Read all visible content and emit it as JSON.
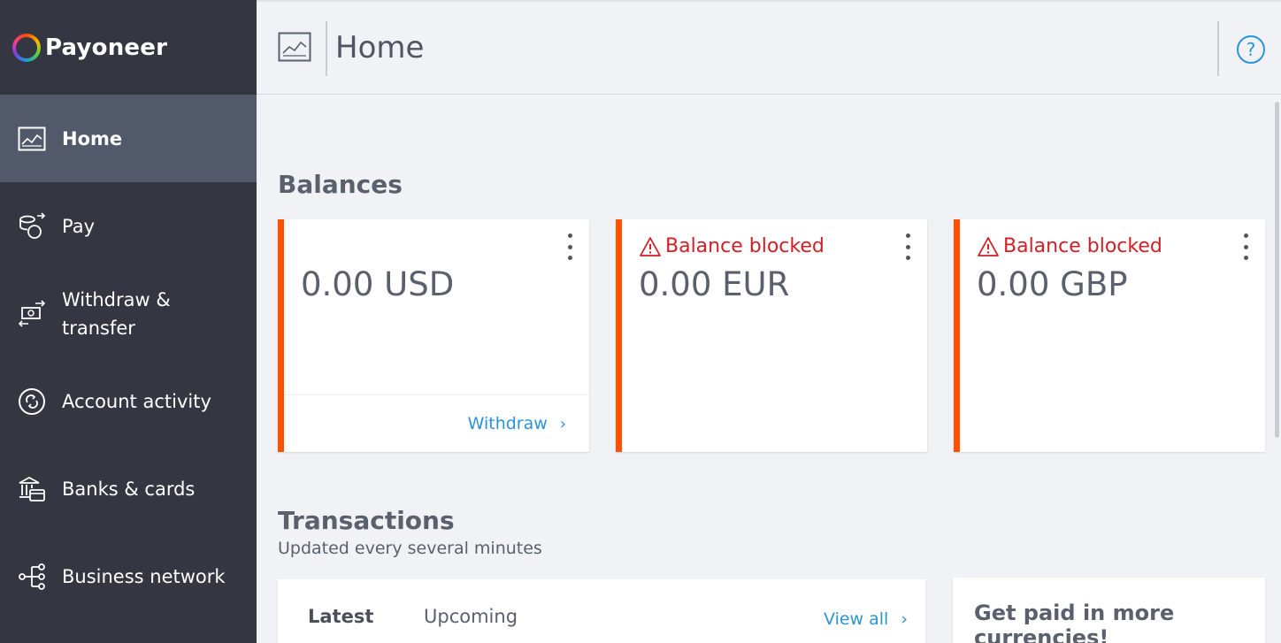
{
  "brand": {
    "name": "Payoneer"
  },
  "sidebar": {
    "items": [
      {
        "label": "Home",
        "icon": "home-chart-icon"
      },
      {
        "label": "Pay",
        "icon": "pay-icon"
      },
      {
        "label": "Withdraw & transfer",
        "icon": "withdraw-transfer-icon"
      },
      {
        "label": "Account activity",
        "icon": "account-activity-icon"
      },
      {
        "label": "Banks & cards",
        "icon": "bank-cards-icon"
      },
      {
        "label": "Business network",
        "icon": "business-network-icon"
      }
    ]
  },
  "header": {
    "title": "Home",
    "help_symbol": "?"
  },
  "balances": {
    "title": "Balances",
    "cards": [
      {
        "amount": "0.00 USD",
        "action": "Withdraw",
        "action_chevron": "›"
      },
      {
        "status": "Balance blocked",
        "amount": "0.00 EUR"
      },
      {
        "status": "Balance blocked",
        "amount": "0.00 GBP"
      }
    ]
  },
  "transactions": {
    "title": "Transactions",
    "subtitle": "Updated every several minutes",
    "tabs": [
      "Latest",
      "Upcoming"
    ],
    "view_all": "View all",
    "view_all_chevron": "›"
  },
  "promo": {
    "title": "Get paid in more currencies!"
  },
  "colors": {
    "sidebar_bg": "#343741",
    "sidebar_active": "#51596a",
    "accent_orange": "#ff5200",
    "link_blue": "#2a94d6",
    "blocked_red": "#d01f25"
  }
}
